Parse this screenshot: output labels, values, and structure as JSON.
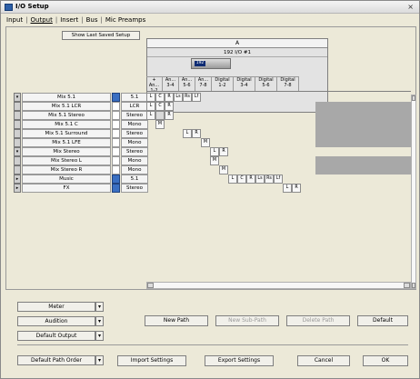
{
  "window": {
    "title": "I/O Setup"
  },
  "tabs": [
    "Input",
    "Output",
    "Insert",
    "Bus",
    "Mic Preamps"
  ],
  "active_tab": "Output",
  "panel": {
    "show_last_saved_label": "Show Last Saved Setup",
    "interface": {
      "letter": "A",
      "name": "192 I/O #1",
      "device_tag": "192"
    },
    "columns": [
      {
        "line1": "+ An...",
        "line2": "1-2"
      },
      {
        "line1": "An...",
        "line2": "3-4"
      },
      {
        "line1": "An...",
        "line2": "5-6"
      },
      {
        "line1": "An...",
        "line2": "7-8"
      },
      {
        "line1": "Digital",
        "line2": "1-2"
      },
      {
        "line1": "Digital",
        "line2": "3-4"
      },
      {
        "line1": "Digital",
        "line2": "5-6"
      },
      {
        "line1": "Digital",
        "line2": "7-8"
      }
    ],
    "rows": [
      {
        "name": "Mix 5.1",
        "format": "5.1",
        "link": true,
        "btn": "▾",
        "cells": [
          "L",
          "C",
          "R",
          "Ls",
          "Rs",
          "Lf"
        ],
        "start": 0,
        "gray": false
      },
      {
        "name": "Mix 5.1 LCR",
        "format": "LCR",
        "link": false,
        "btn": "",
        "cells": [
          "L",
          "C",
          "R"
        ],
        "start": 0,
        "gray": true
      },
      {
        "name": "Mix 5.1 Stereo",
        "format": "Stereo",
        "link": false,
        "btn": "",
        "cells": [
          "L",
          "",
          "R"
        ],
        "start": 0,
        "gray": true
      },
      {
        "name": "Mix 5.1 C",
        "format": "Mono",
        "link": false,
        "btn": "",
        "cells": [
          "M"
        ],
        "start": 1,
        "gray": true
      },
      {
        "name": "Mix 5.1 Surround",
        "format": "Stereo",
        "link": false,
        "btn": "",
        "cells": [
          "L",
          "R"
        ],
        "start": 4,
        "gray": true
      },
      {
        "name": "Mix 5.1 LFE",
        "format": "Mono",
        "link": false,
        "btn": "",
        "cells": [
          "M"
        ],
        "start": 6,
        "gray": true
      },
      {
        "name": "Mix Stereo",
        "format": "Stereo",
        "link": false,
        "btn": "▾",
        "cells": [
          "L",
          "R"
        ],
        "start": 7,
        "gray": false
      },
      {
        "name": "Mix Stereo L",
        "format": "Mono",
        "link": false,
        "btn": "",
        "cells": [
          "M"
        ],
        "start": 7,
        "gray": true
      },
      {
        "name": "Mix Stereo R",
        "format": "Mono",
        "link": false,
        "btn": "",
        "cells": [
          "M"
        ],
        "start": 8,
        "gray": true
      },
      {
        "name": "Music",
        "format": "5.1",
        "link": true,
        "btn": "▸",
        "cells": [
          "L",
          "C",
          "R",
          "Ls",
          "Rs",
          "Lf"
        ],
        "start": 9,
        "gray": false
      },
      {
        "name": "FX",
        "format": "Stereo",
        "link": true,
        "btn": "▸",
        "cells": [
          "L",
          "R"
        ],
        "start": 15,
        "gray": false
      }
    ]
  },
  "buttons": {
    "meter": "Meter",
    "audition": "Audition",
    "default_output": "Default Output",
    "new_path": "New Path",
    "new_sub_path": "New Sub-Path",
    "delete_path": "Delete Path",
    "default": "Default",
    "default_path_order": "Default Path Order",
    "import_settings": "Import Settings",
    "export_settings": "Export Settings",
    "cancel": "Cancel",
    "ok": "OK"
  },
  "colors": {
    "link_on": "#3a6fc2",
    "grid_gray": "#a8a8a8",
    "device_tag": "#0d2b73"
  },
  "icons": {
    "menu_arrow": "▾",
    "close": "×",
    "up": "▴",
    "down": "▾",
    "left": "◂",
    "right": "▸"
  }
}
